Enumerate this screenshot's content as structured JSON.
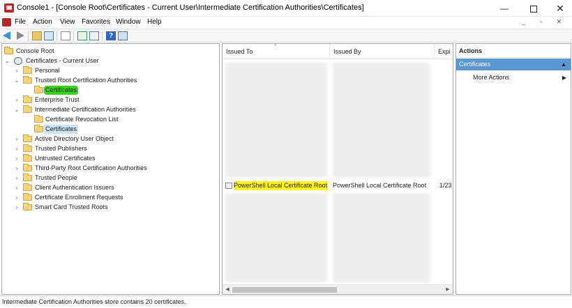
{
  "window": {
    "title": "Console1 - [Console Root\\Certificates - Current User\\Intermediate Certification Authorities\\Certificates]",
    "minimize_glyph": "—",
    "close_glyph": "✕"
  },
  "menubar": {
    "items": [
      "File",
      "Action",
      "View",
      "Favorites",
      "Window",
      "Help"
    ],
    "child_controls": "_ ▫ ✕"
  },
  "toolbar": {
    "icons": [
      "back-arrow",
      "forward-arrow",
      "up-one-level",
      "show-hide-console-tree",
      "export-list",
      "refresh",
      "export",
      "help",
      "properties"
    ]
  },
  "tree": {
    "root": "Console Root",
    "store": "Certificates - Current User",
    "nodes": [
      {
        "label": "Personal"
      },
      {
        "label": "Trusted Root Certification Authorities"
      },
      {
        "label": "Certificates"
      },
      {
        "label": "Enterprise Trust"
      },
      {
        "label": "Intermediate Certification Authorities"
      },
      {
        "label": "Certificate Revocation List"
      },
      {
        "label": "Certificates"
      },
      {
        "label": "Active Directory User Object"
      },
      {
        "label": "Trusted Publishers"
      },
      {
        "label": "Untrusted Certificates"
      },
      {
        "label": "Third-Party Root Certification Authorities"
      },
      {
        "label": "Trusted People"
      },
      {
        "label": "Client Authentication Issuers"
      },
      {
        "label": "Certificate Enrollment Requests"
      },
      {
        "label": "Smart Card Trusted Roots"
      }
    ],
    "glyphs": {
      "collapsed": "›",
      "expanded": "⌄"
    }
  },
  "list": {
    "columns": [
      "Issued To",
      "Issued By",
      "Expi"
    ],
    "sort_glyph": "^",
    "visible_row": {
      "issued_to": "PowerShell Local Certificate Root",
      "issued_by": "PowerShell Local Certificate Root",
      "expiration": "1/23"
    },
    "scroll_glyphs": {
      "left": "◀",
      "right": "▶"
    }
  },
  "actions": {
    "title": "Actions",
    "section": "Certificates",
    "section_glyph": "▲",
    "items": [
      {
        "label": "More Actions",
        "glyph": "▶"
      }
    ]
  },
  "status": {
    "text": "Intermediate Certification Authorities store contains 20 certificates."
  },
  "colors": {
    "highlight_green": "#37d21a",
    "highlight_yellow": "#fff21f",
    "selection": "#cce4f7",
    "actions_header": "#5a96d2"
  }
}
